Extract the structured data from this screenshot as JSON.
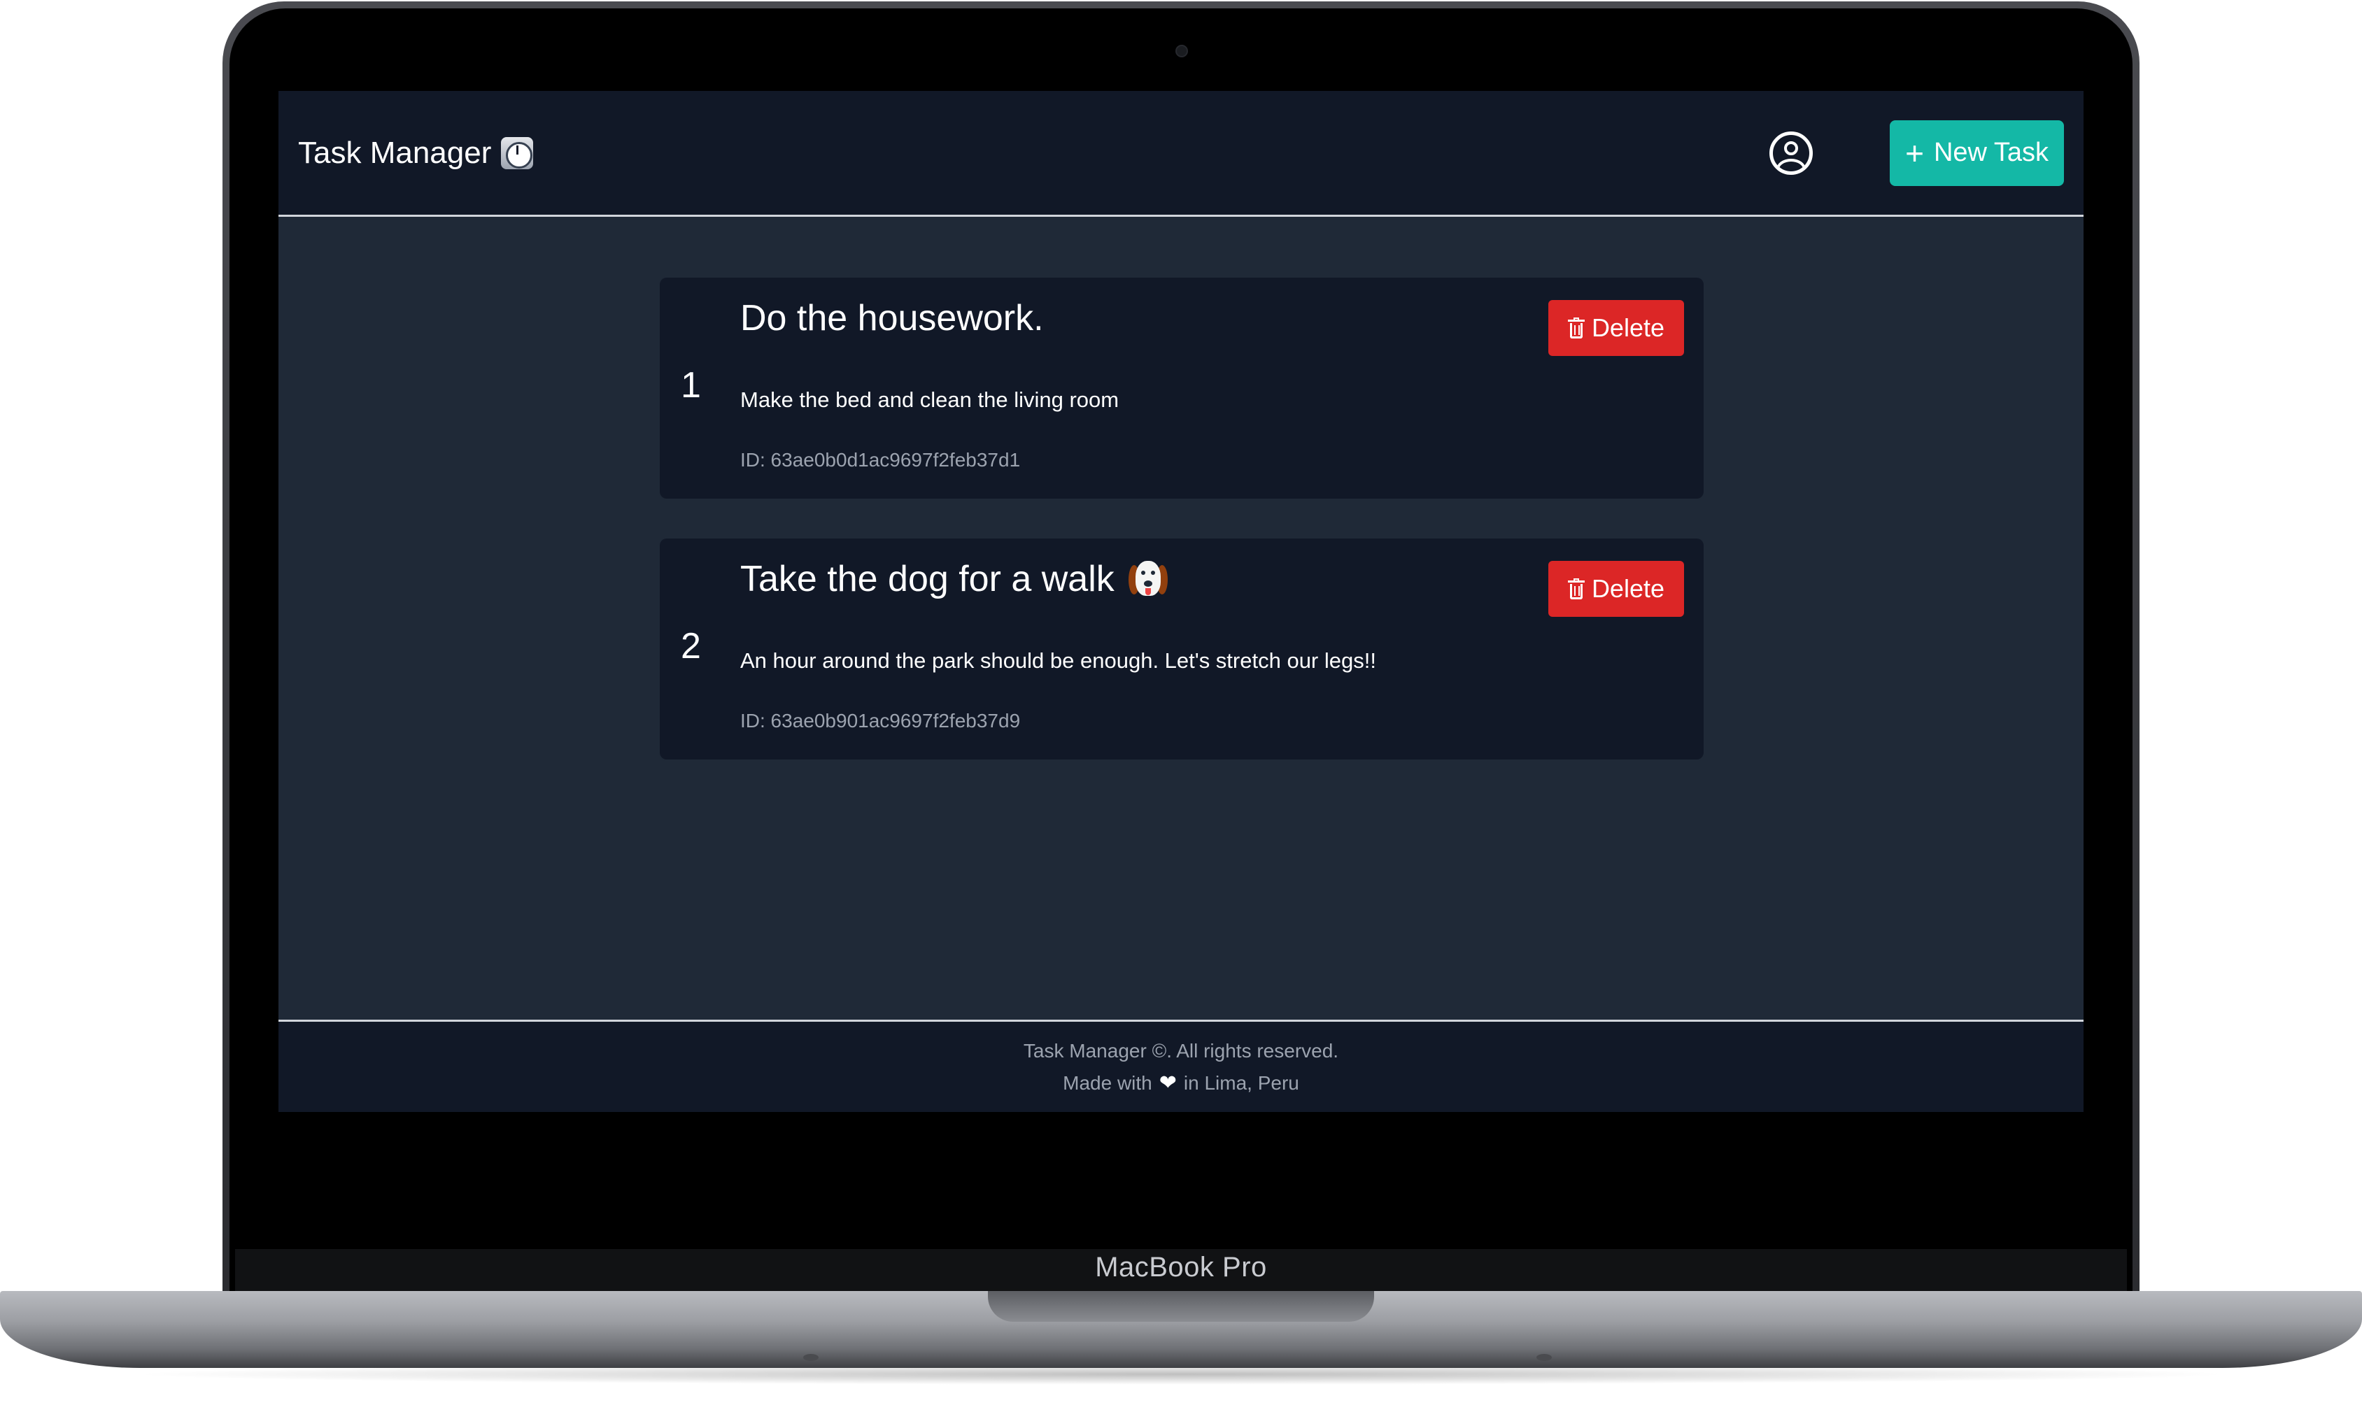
{
  "navbar": {
    "title": "Task Manager",
    "title_icon": "clock-icon",
    "user_icon": "user-circle-icon",
    "new_task_label": "New Task",
    "new_task_icon": "plus-icon"
  },
  "tasks": [
    {
      "index": "1",
      "title": "Do the housework.",
      "description": "Make the bed and clean the living room",
      "id_text": "ID: 63ae0b0d1ac9697f2feb37d1",
      "delete_label": "Delete"
    },
    {
      "index": "2",
      "title": "Take the dog for a walk",
      "title_icon": "dog-face-icon",
      "description": "An hour around the park should be enough. Let's stretch our legs!!",
      "id_text": "ID: 63ae0b901ac9697f2feb37d9",
      "delete_label": "Delete"
    }
  ],
  "footer": {
    "copyright": "Task Manager ©. All rights reserved.",
    "made_with": "Made with",
    "location": "in Lima, Peru",
    "heart_icon": "heart-icon"
  },
  "device": {
    "label": "MacBook Pro"
  },
  "colors": {
    "app_bg": "#1f2937",
    "navbar_bg": "#111827",
    "card_bg": "#111827",
    "accent": "#14b8a6",
    "danger": "#dc2626"
  }
}
